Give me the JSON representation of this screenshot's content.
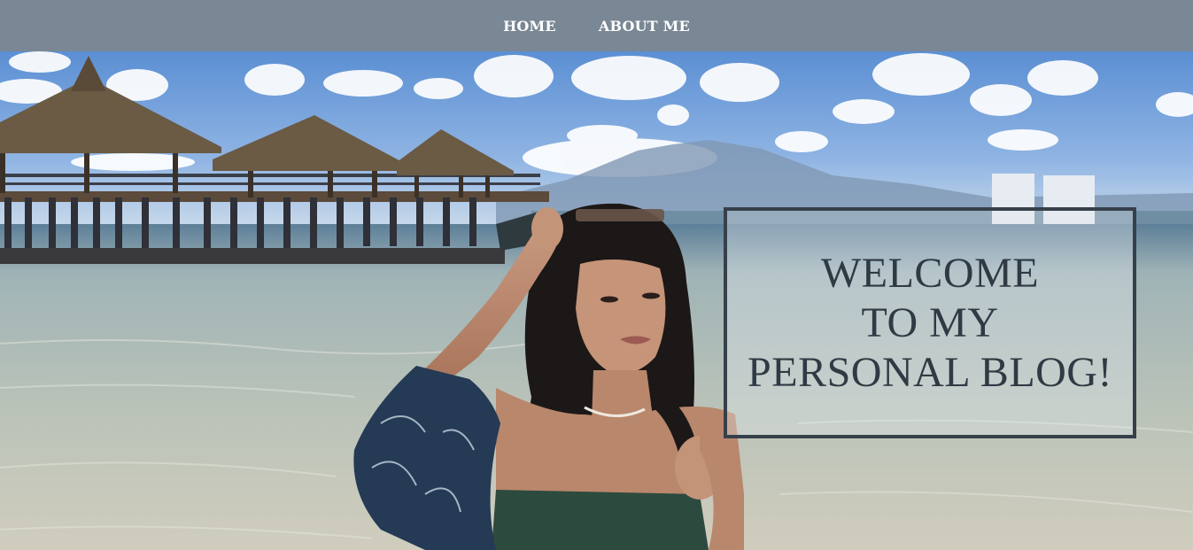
{
  "nav": {
    "items": [
      {
        "label": "HOME"
      },
      {
        "label": "ABOUT ME"
      }
    ]
  },
  "hero": {
    "welcome_lines": [
      "WELCOME",
      "TO MY",
      "PERSONAL BLOG!"
    ],
    "image_subject": "woman-at-beach-with-pier"
  },
  "colors": {
    "navbar": "#7a8794",
    "nav_text": "#ffffff",
    "box_border": "#36404a",
    "welcome_text": "#2f3a44"
  }
}
